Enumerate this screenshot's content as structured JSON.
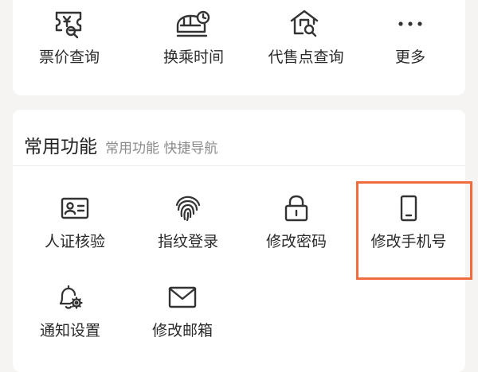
{
  "top_grid": {
    "items": [
      {
        "label": "票价查询",
        "icon": "ticket-price-icon"
      },
      {
        "label": "换乘时间",
        "icon": "transfer-time-icon"
      },
      {
        "label": "代售点查询",
        "icon": "agency-search-icon"
      },
      {
        "label": "更多",
        "icon": "more-dots-icon"
      }
    ]
  },
  "common_functions": {
    "title": "常用功能",
    "subtitle": "常用功能 快捷导航",
    "items": [
      {
        "label": "人证核验",
        "icon": "id-card-icon"
      },
      {
        "label": "指纹登录",
        "icon": "fingerprint-icon"
      },
      {
        "label": "修改密码",
        "icon": "lock-icon"
      },
      {
        "label": "修改手机号",
        "icon": "phone-icon"
      },
      {
        "label": "通知设置",
        "icon": "bell-settings-icon"
      },
      {
        "label": "修改邮箱",
        "icon": "envelope-icon"
      }
    ]
  },
  "colors": {
    "background": "#f6f4f3",
    "card": "#ffffff",
    "highlight": "#f26b3c",
    "icon_stroke": "#333333"
  }
}
